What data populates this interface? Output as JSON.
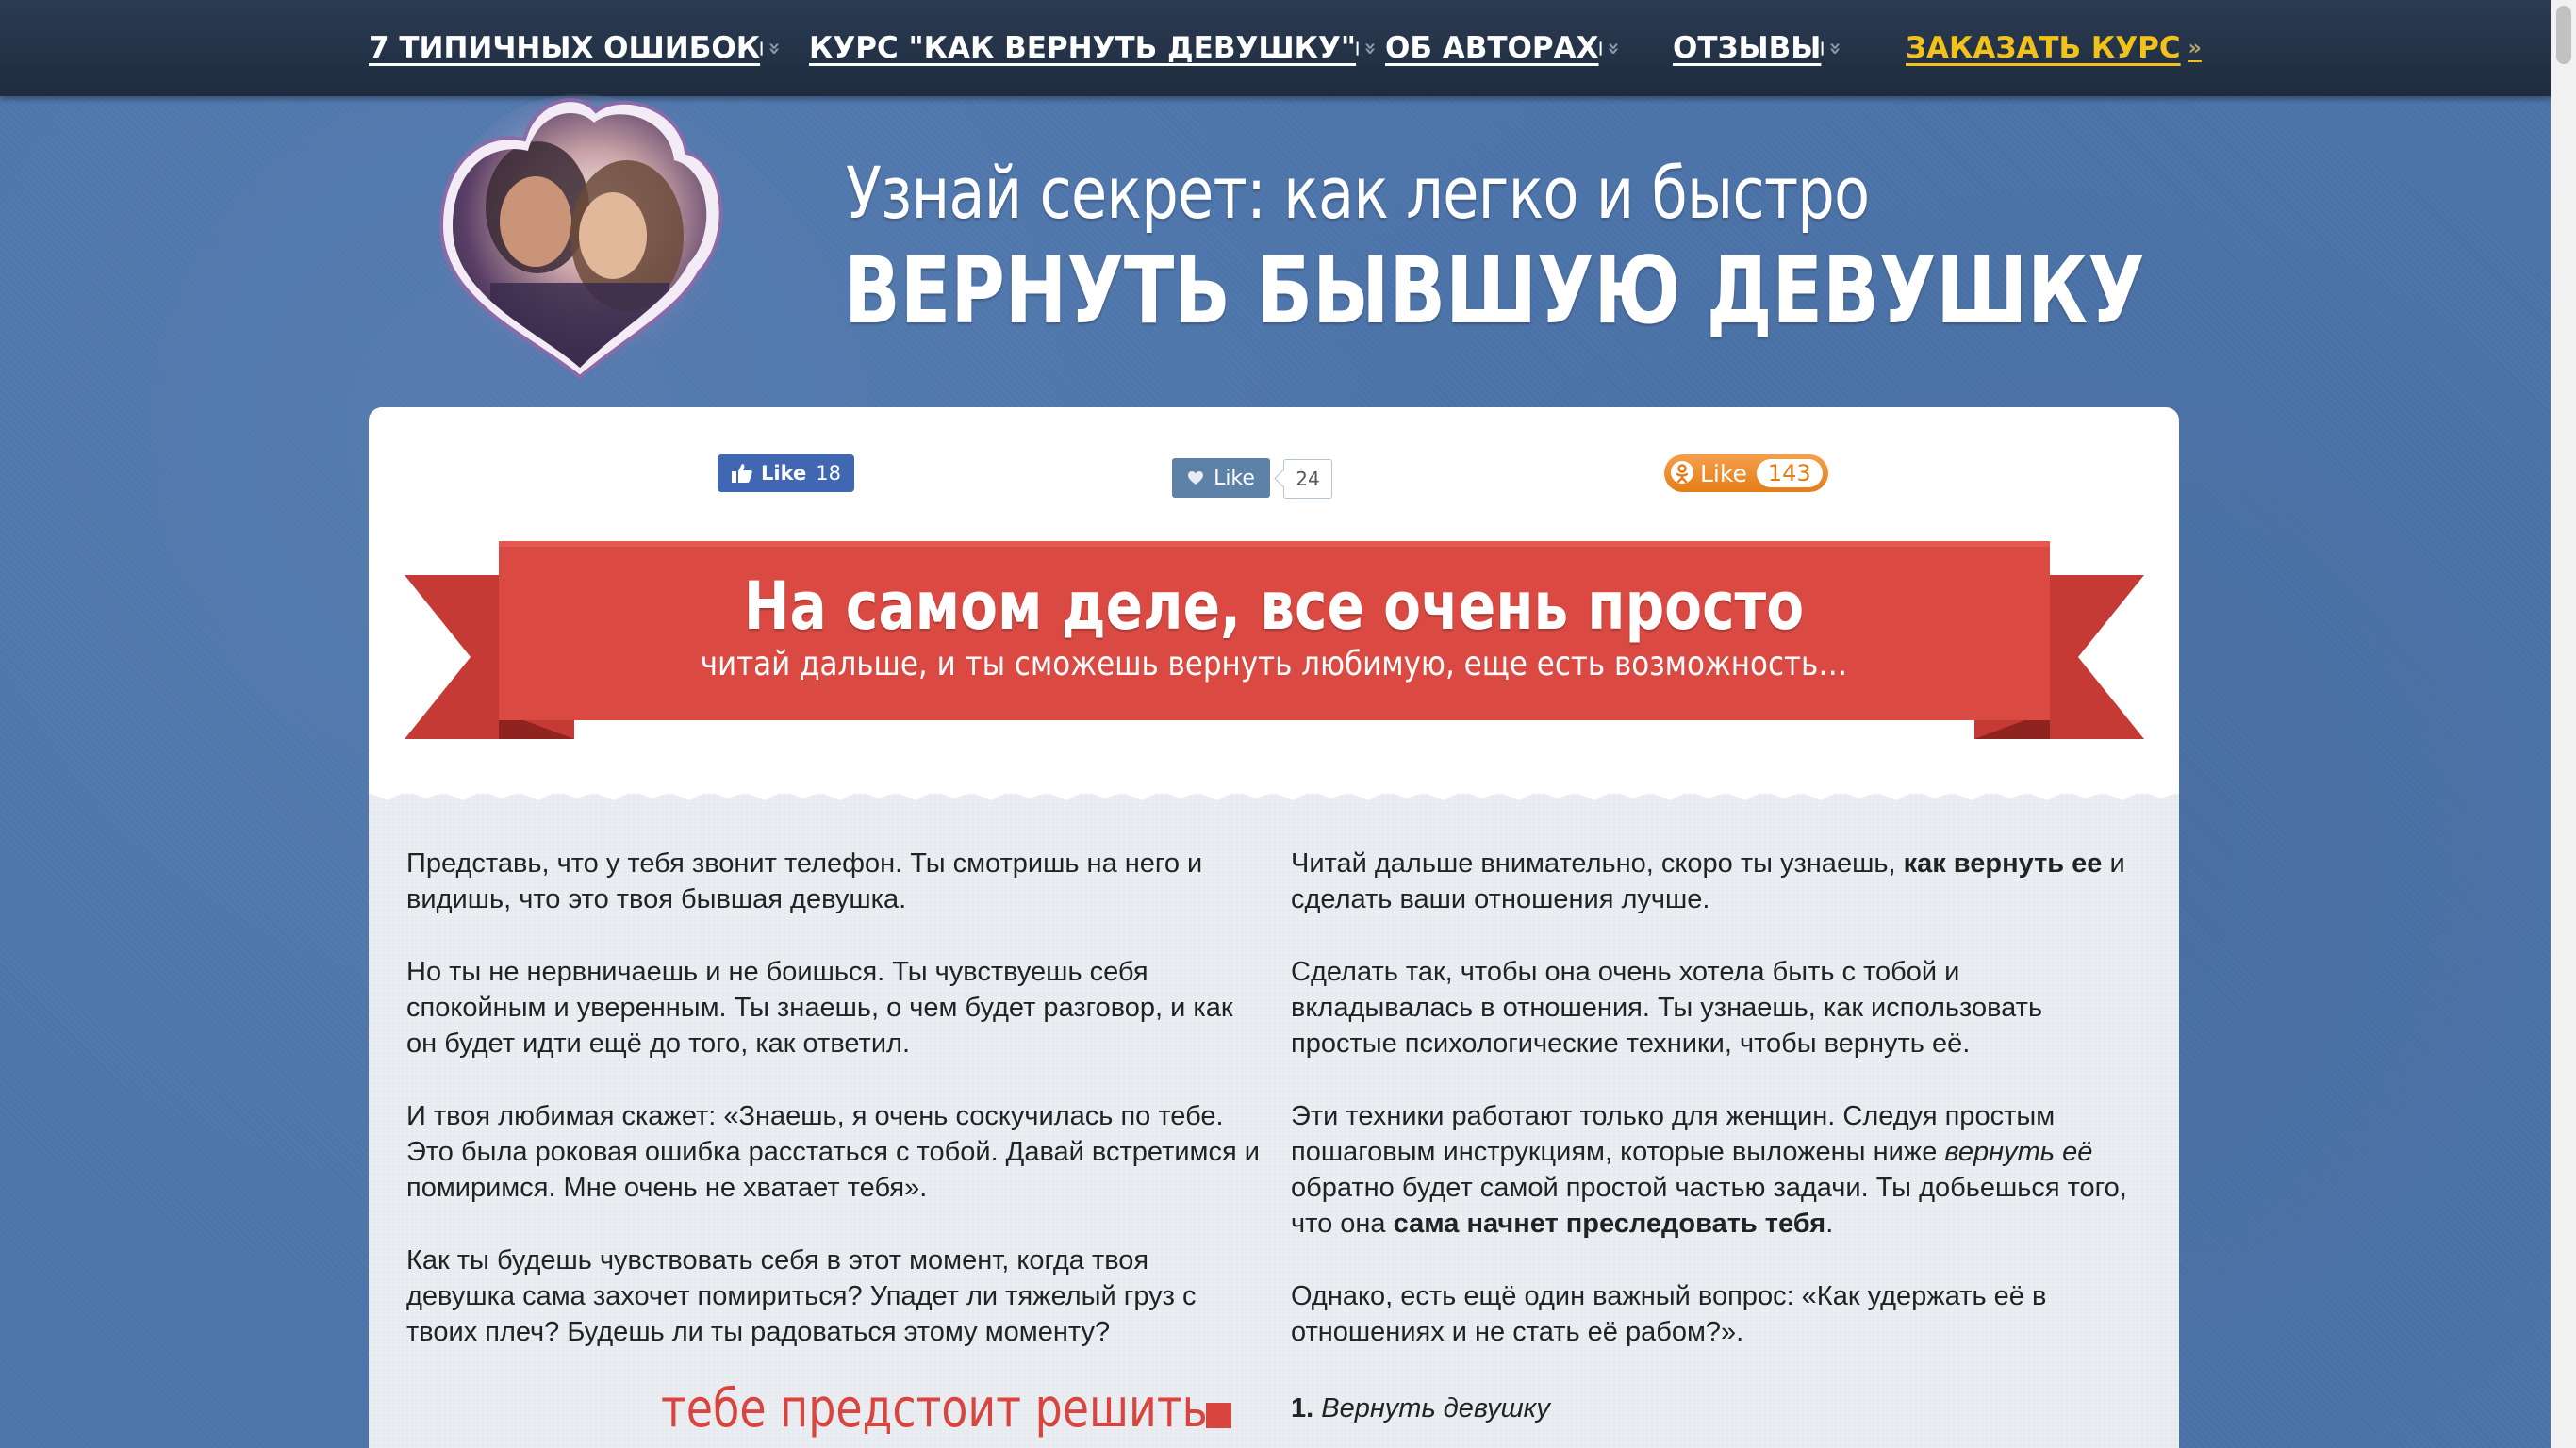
{
  "nav": {
    "items": [
      {
        "label": "7 ТИПИЧНЫХ ОШИБОК",
        "accent": false
      },
      {
        "label": "КУРС \"КАК ВЕРНУТЬ ДЕВУШКУ\"",
        "accent": false
      },
      {
        "label": "ОБ АВТОРАХ",
        "accent": false
      },
      {
        "label": "ОТЗЫВЫ",
        "accent": false
      },
      {
        "label": "ЗАКАЗАТЬ КУРС",
        "accent": true
      }
    ],
    "chevron_down": "»",
    "chevron_right": "»"
  },
  "header": {
    "line1": "Узнай секрет: как легко и быстро",
    "line2": "ВЕРНУТЬ БЫВШУЮ ДЕВУШКУ"
  },
  "social": {
    "facebook": {
      "label": "Like",
      "count": "18"
    },
    "vk": {
      "label": "Like",
      "count": "24"
    },
    "ok": {
      "label": "Like",
      "count": "143"
    }
  },
  "ribbon": {
    "title": "На самом деле, все очень просто",
    "subtitle": "читай дальше, и ты сможешь вернуть любимую, еще есть возможность…"
  },
  "left_column": [
    "Представь, что у тебя звонит телефон. Ты смотришь на него и видишь, что это твоя бывшая девушка.",
    "Но ты не нервничаешь и не боишься. Ты чувствуешь себя спокойным и уверенным. Ты знаешь, о чем будет разговор, и как он будет идти ещё до того, как ответил.",
    "И твоя любимая скажет: «Знаешь, я очень соскучилась по тебе. Это была роковая ошибка расстаться с тобой. Давай встретимся и помиримся. Мне очень не хватает тебя».",
    "Как ты будешь чувствовать себя в этот момент, когда твоя девушка сама захочет помириться? Упадет ли тяжелый груз с твоих плеч? Будешь ли ты радоваться этому моменту?"
  ],
  "right_column": {
    "p1_a": "Читай дальше внимательно, скоро ты узнаешь, ",
    "p1_b": "как вернуть ее",
    "p1_c": " и сделать ваши отношения лучше.",
    "p2": "Сделать так, чтобы она очень хотела быть с тобой и вкладывалась в отношения. Ты узнаешь, как использовать простые психологические техники, чтобы вернуть её.",
    "p3_a": "Эти техники работают только для женщин. Следуя простым пошаговым инструкциям, которые выложены ниже ",
    "p3_b": "вернуть её",
    "p3_c": " обратно будет самой простой частью задачи. Ты добьешься того, что она ",
    "p3_d": "сама начнет преследовать тебя",
    "p3_e": ".",
    "p4": "Однако, есть ещё один важный вопрос: «Как удержать её в отношениях и не стать её рабом?»."
  },
  "decide_text": "тебе предстоит решить",
  "list": {
    "number": "1.",
    "text": "Вернуть девушку"
  },
  "colors": {
    "nav_bg": "#1f2c3f",
    "accent": "#f2c21a",
    "ribbon_red": "#d9453e",
    "page_blue": "#4c74aa"
  }
}
